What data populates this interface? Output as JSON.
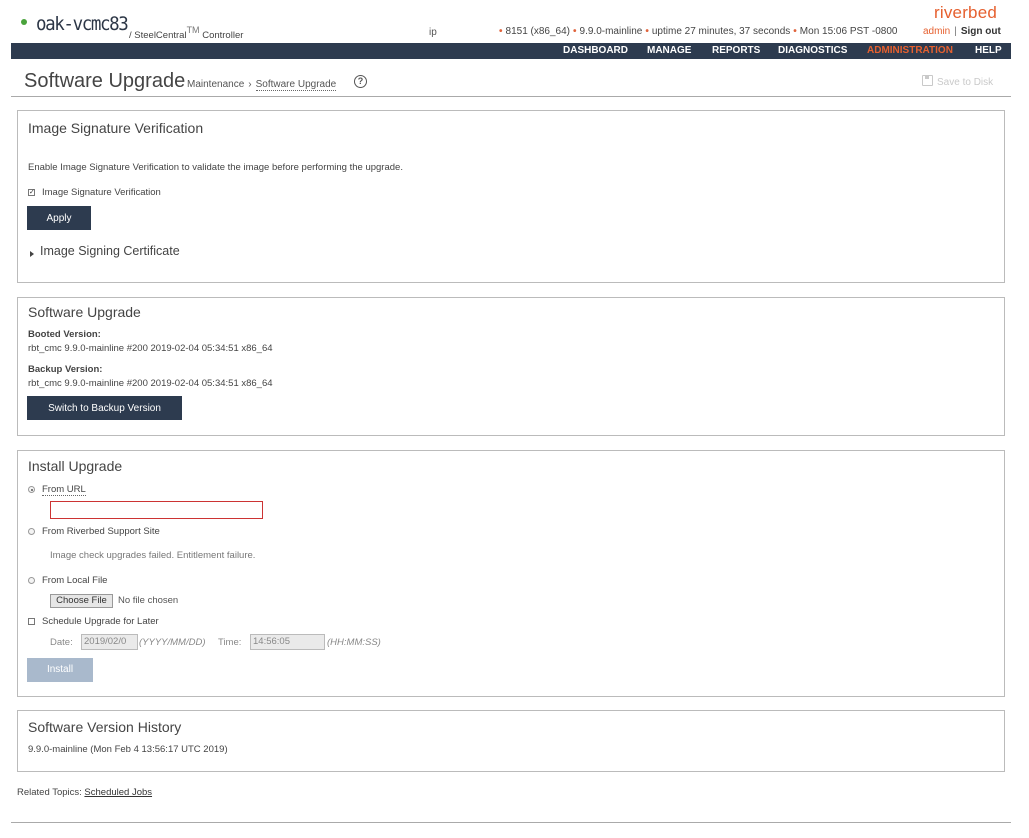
{
  "header": {
    "hostname": "oak-vcmc83",
    "product": "/ SteelCentral",
    "product_tm": "TM",
    "product_suffix": "Controller",
    "ip_label": "ip",
    "model": "8151 (x86_64)",
    "version": "9.9.0-mainline",
    "uptime": "uptime 27 minutes, 37 seconds",
    "datetime": "Mon 15:06 PST -0800",
    "brand": "riverbed",
    "user": "admin",
    "separator": "|",
    "sign_out": "Sign out",
    "colors": {
      "brand": "#e6602f",
      "status_ok": "#4aa33b",
      "nav_bg": "#2d3b4f"
    }
  },
  "nav": {
    "dashboard": "DASHBOARD",
    "manage": "MANAGE",
    "reports": "REPORTS",
    "diagnostics": "DIAGNOSTICS",
    "administration": "ADMINISTRATION",
    "help": "HELP",
    "active": "ADMINISTRATION"
  },
  "page": {
    "title": "Software Upgrade",
    "breadcrumb": {
      "parent": "Maintenance",
      "separator": "›",
      "current": "Software Upgrade"
    },
    "help_icon": "?",
    "save_to_disk": "Save to Disk"
  },
  "sig_verification": {
    "title": "Image Signature Verification",
    "description": "Enable Image Signature Verification to validate the image before performing the upgrade.",
    "checkbox_label": "Image Signature Verification",
    "checkbox_checked": true,
    "apply_label": "Apply",
    "cert_label": "Image Signing Certificate"
  },
  "software_upgrade": {
    "title": "Software Upgrade",
    "booted_label": "Booted Version:",
    "booted_value": "rbt_cmc 9.9.0-mainline #200 2019-02-04 05:34:51 x86_64",
    "backup_label": "Backup Version:",
    "backup_value": "rbt_cmc 9.9.0-mainline #200 2019-02-04 05:34:51 x86_64",
    "switch_label": "Switch to Backup Version"
  },
  "install_upgrade": {
    "title": "Install Upgrade",
    "from_url_label": "From URL",
    "url_value": "",
    "from_support_label": "From Riverbed Support Site",
    "support_message": "Image check upgrades failed. Entitlement failure.",
    "from_local_label": "From Local File",
    "choose_file_label": "Choose File",
    "no_file_label": "No file chosen",
    "schedule_label": "Schedule Upgrade for Later",
    "date_label": "Date:",
    "date_value": "2019/02/0",
    "date_hint": "(YYYY/MM/DD)",
    "time_label": "Time:",
    "time_value": "14:56:05",
    "time_hint": "(HH:MM:SS)",
    "install_label": "Install"
  },
  "history": {
    "title": "Software Version History",
    "entry": "9.9.0-mainline (Mon Feb 4 13:56:17 UTC 2019)"
  },
  "related": {
    "label": "Related Topics:",
    "link": "Scheduled Jobs"
  }
}
